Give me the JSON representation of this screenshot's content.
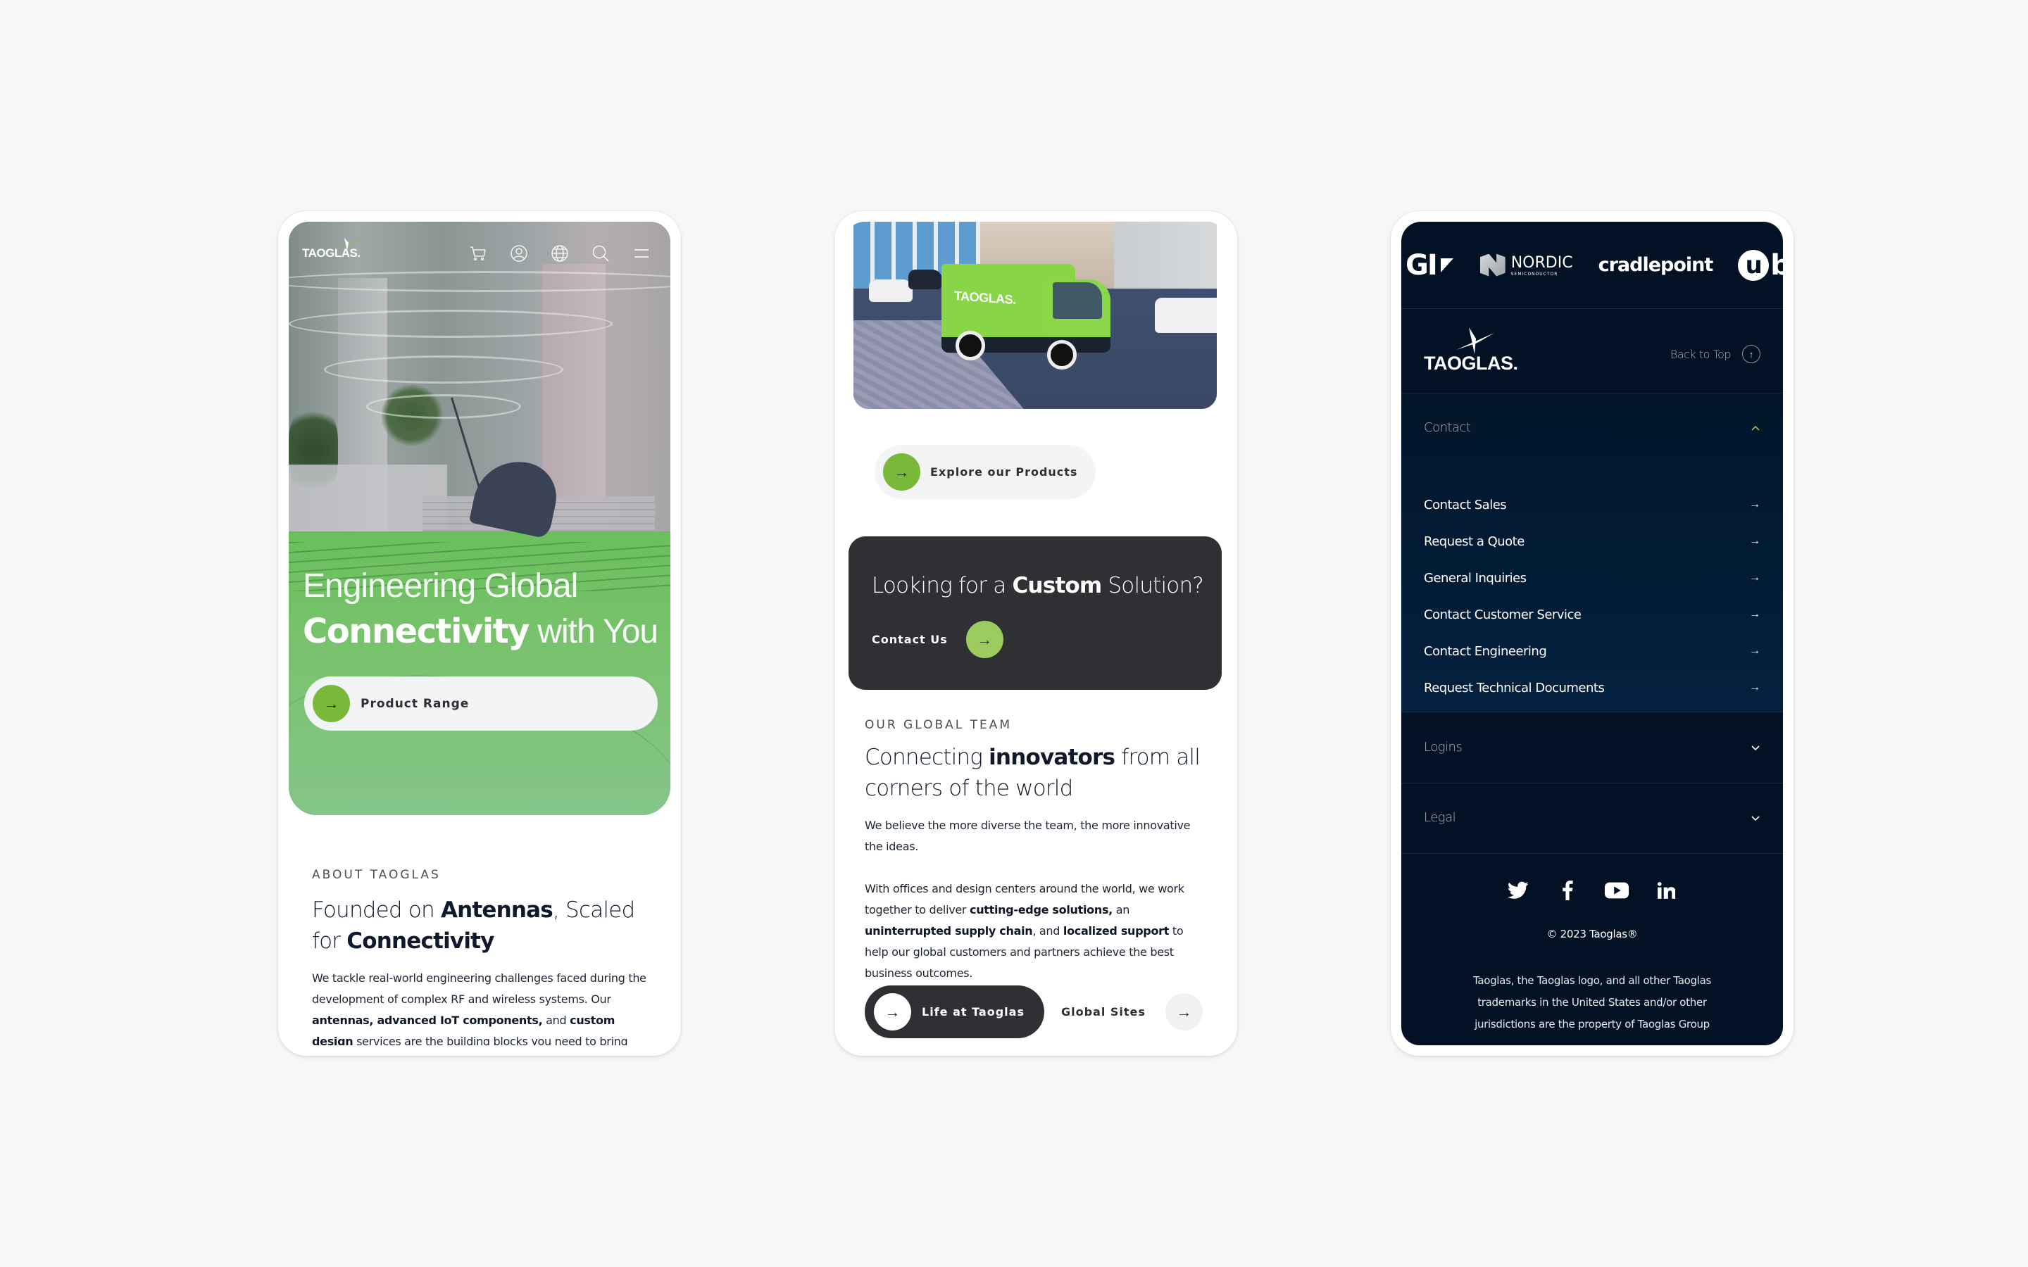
{
  "colors": {
    "background": "#f7f7f7",
    "brand_green": "#79b93a",
    "accent_green_light": "#9ccc60",
    "dark_card": "#2f3033",
    "footer_navy": "#021224",
    "text_dark": "#0e1a2b"
  },
  "phone1": {
    "logo": "TAOGLAS.",
    "nav_icons": [
      "cart-icon",
      "account-icon",
      "globe-icon",
      "search-icon",
      "menu-icon"
    ],
    "hero": {
      "title_line1": "Engineering Global",
      "title_bold": "Connectivity",
      "title_rest": " with You",
      "button_label": "Product Range"
    },
    "about": {
      "eyebrow": "ABOUT TAOGLAS",
      "heading_part1": "Founded on ",
      "heading_bold1": "Antennas",
      "heading_part2": ", Scaled for ",
      "heading_bold2": "Connectivity",
      "body_part1": "We tackle real-world engineering challenges faced during the development of complex RF and wireless systems. Our ",
      "body_bold1": "antennas, advanced IoT components,",
      "body_part2": " and ",
      "body_bold2": "custom design",
      "body_part3": " services are the building blocks you need to bring"
    }
  },
  "phone2": {
    "van_logo": "TAOGLAS.",
    "explore_button": "Explore our Products",
    "custom_card": {
      "title_part1": "Looking for a ",
      "title_bold": "Custom",
      "title_part2": " Solution?",
      "link_label": "Contact Us"
    },
    "team": {
      "eyebrow": "OUR GLOBAL TEAM",
      "heading_part1": "Connecting ",
      "heading_bold": "innovators",
      "heading_part2": " from all corners of the world",
      "para1": "We believe the more diverse the team, the more innovative the ideas.",
      "para2_part1": "With offices and design centers around the world, we work together to deliver ",
      "para2_bold1": "cutting-edge solutions,",
      "para2_part2": " an ",
      "para2_bold2": "uninterrupted supply chain",
      "para2_part3": ", and ",
      "para2_bold3": "localized support",
      "para2_part4": " to help our global customers and partners achieve the best business outcomes."
    },
    "life_button": "Life at Taoglas",
    "global_sites_link": "Global Sites"
  },
  "phone3": {
    "partners": [
      {
        "name": "GI",
        "label": "GI"
      },
      {
        "name": "nordic",
        "label": "NORDIC",
        "sub": "SEMICONDUCTOR"
      },
      {
        "name": "cradlepoint",
        "label": "cradlepoint"
      },
      {
        "name": "ublox",
        "label": "blox"
      }
    ],
    "logo": "TAOGLAS.",
    "back_to_top": "Back to Top",
    "contact": {
      "heading": "Contact",
      "expanded": true,
      "items": [
        "Contact Sales",
        "Request a Quote",
        "General Inquiries",
        "Contact Customer Service",
        "Contact Engineering",
        "Request Technical Documents"
      ]
    },
    "logins": {
      "heading": "Logins",
      "expanded": false
    },
    "legal": {
      "heading": "Legal",
      "expanded": false
    },
    "socials": [
      "twitter-icon",
      "facebook-icon",
      "youtube-icon",
      "linkedin-icon"
    ],
    "copyright": "© 2023 Taoglas®",
    "legal_text": "Taoglas, the Taoglas logo, and all other Taoglas trademarks in the United States and/or other jurisdictions are the property of Taoglas Group"
  }
}
